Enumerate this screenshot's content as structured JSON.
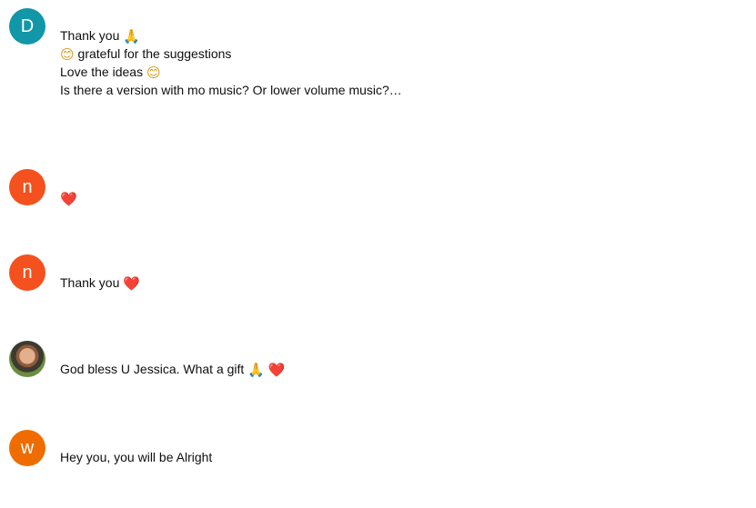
{
  "comments": [
    {
      "avatar_letter": "D",
      "avatar_color": "#1197a8",
      "lines": [
        {
          "text": "Thank you ",
          "emoji": "🙏",
          "emoji_name": "folded-hands-icon"
        },
        {
          "lead_emoji": "😊",
          "lead_emoji_name": "smiling-face-icon",
          "text": " grateful for the suggestions"
        },
        {
          "text": "Love the ideas ",
          "emoji": "😊",
          "emoji_name": "smiling-face-icon"
        },
        {
          "text": "Is there a version with mo music? Or lower volume music?…"
        }
      ]
    },
    {
      "avatar_letter": "n",
      "avatar_color": "#f4511e",
      "lines": [
        {
          "text": "",
          "emoji": "❤️",
          "emoji_name": "red-heart-icon"
        }
      ]
    },
    {
      "avatar_letter": "n",
      "avatar_color": "#f4511e",
      "lines": [
        {
          "text": "Thank you ",
          "emoji": "❤️",
          "emoji_name": "red-heart-icon"
        }
      ]
    },
    {
      "avatar_letter": "",
      "avatar_color": "#6b8e3e",
      "lines": [
        {
          "text": "God bless U Jessica. What a gift ",
          "emoji": "🙏",
          "emoji_name": "folded-hands-icon",
          "emoji2": "❤️",
          "emoji2_name": "red-heart-icon"
        }
      ]
    },
    {
      "avatar_letter": "w",
      "avatar_color": "#ef6c00",
      "lines": [
        {
          "text": "Hey you, you will be Alright"
        }
      ]
    }
  ]
}
